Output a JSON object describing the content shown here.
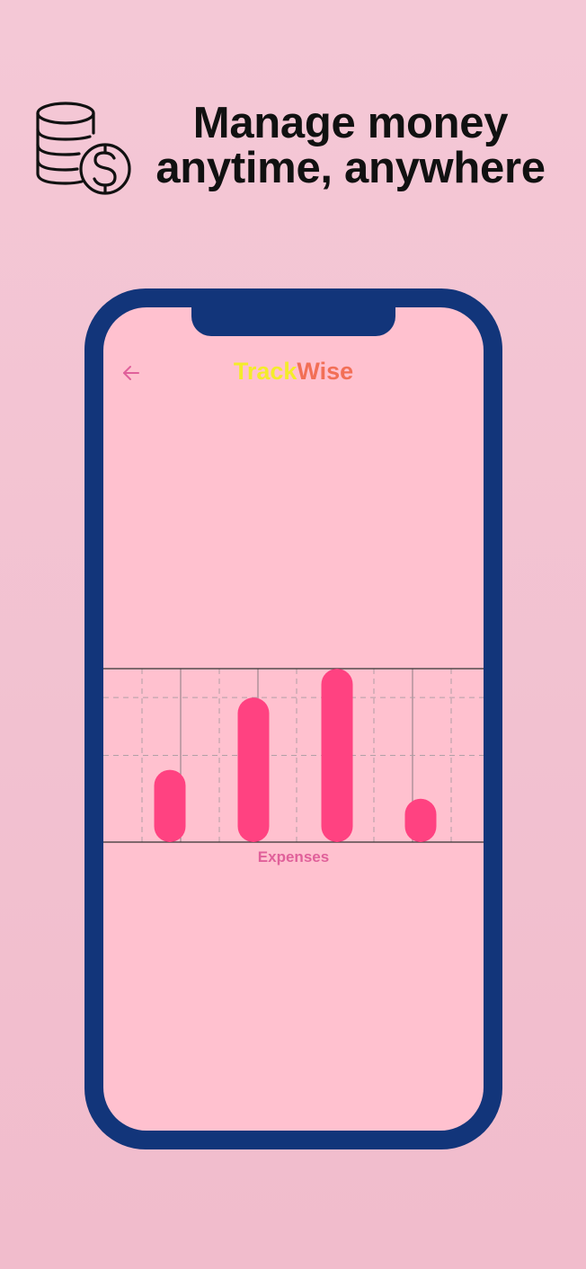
{
  "promo": {
    "headline_line1": "Manage money",
    "headline_line2": "anytime, anywhere",
    "icon": "coins-dollar-icon"
  },
  "app": {
    "title_part1": "Track",
    "title_part2": "Wise",
    "back_icon": "arrow-left-icon",
    "colors": {
      "screen_bg": "#ffc1cf",
      "phone_frame": "#12357a",
      "title_part1": "#f4ec2a",
      "title_part2": "#f26f56",
      "bar": "#ff4281",
      "chart_label": "#e0609a"
    }
  },
  "chart_data": {
    "type": "bar",
    "title": "",
    "xlabel": "Expenses",
    "ylabel": "",
    "categories": [
      "",
      "",
      "",
      ""
    ],
    "values": [
      2.5,
      5,
      6,
      1.5
    ],
    "ylim": [
      0,
      6
    ],
    "grid": true,
    "legend": "none"
  }
}
